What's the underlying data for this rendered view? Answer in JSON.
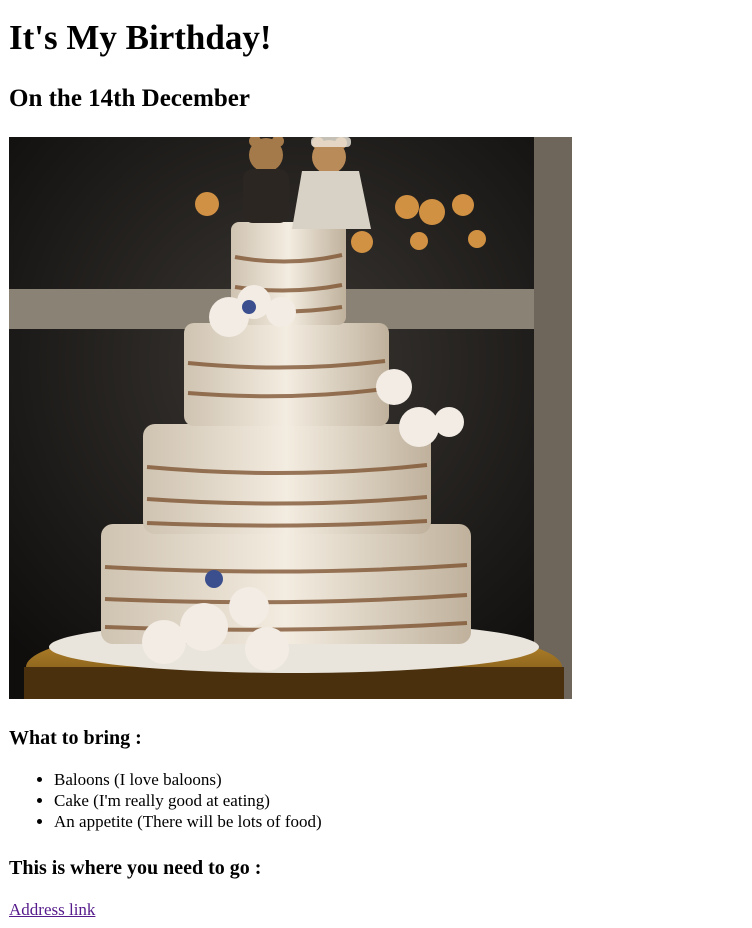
{
  "page": {
    "title": "It's My Birthday!",
    "subtitle": "On the 14th December"
  },
  "image": {
    "alt": "cake-photo"
  },
  "bring": {
    "heading": "What to bring :",
    "items": [
      "Baloons (I love baloons)",
      "Cake (I'm really good at eating)",
      "An appetite (There will be lots of food)"
    ]
  },
  "location": {
    "heading": "This is where you need to go :",
    "link_label": "Address link"
  }
}
